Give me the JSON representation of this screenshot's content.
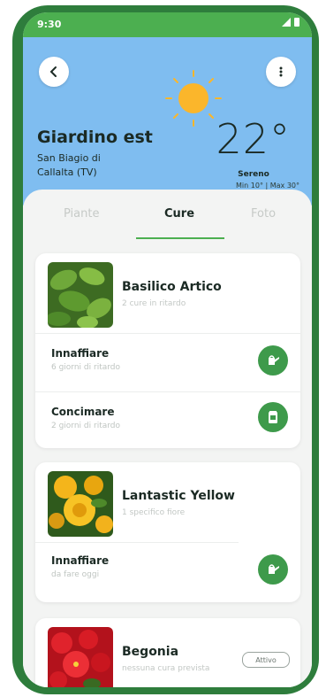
{
  "status_bar": {
    "time": "9:30"
  },
  "header": {
    "location_name": "Giardino est",
    "location_line1": "San Biagio di",
    "location_line2": "Callalta (TV)",
    "temperature": "22°",
    "condition": "Sereno",
    "min_max": "Min 10° | Max 30°",
    "weather_icon": "sun-icon",
    "colors": {
      "sky": "#7fbdf0",
      "accent": "#4caf50",
      "frame": "#2e7d3c"
    }
  },
  "tabs": [
    {
      "label": "Piante"
    },
    {
      "label": "Cure"
    },
    {
      "label": "Foto"
    }
  ],
  "active_tab": "Cure",
  "cards": [
    {
      "name": "Basilico Artico",
      "subtitle": "2 cure in ritardo",
      "tasks": [
        {
          "title": "Innaffiare",
          "subtitle": "6 giorni di ritardo",
          "icon": "watering-can-icon"
        },
        {
          "title": "Concimare",
          "subtitle": "2 giorni di ritardo",
          "icon": "fertilizer-icon"
        }
      ]
    },
    {
      "name": "Lantastic Yellow",
      "subtitle": "1 specifico fiore",
      "tasks": [
        {
          "title": "Innaffiare",
          "subtitle": "da fare oggi",
          "icon": "watering-can-icon"
        }
      ]
    },
    {
      "name": "Begonia",
      "subtitle": "nessuna cura prevista",
      "status": "Attivo"
    }
  ]
}
